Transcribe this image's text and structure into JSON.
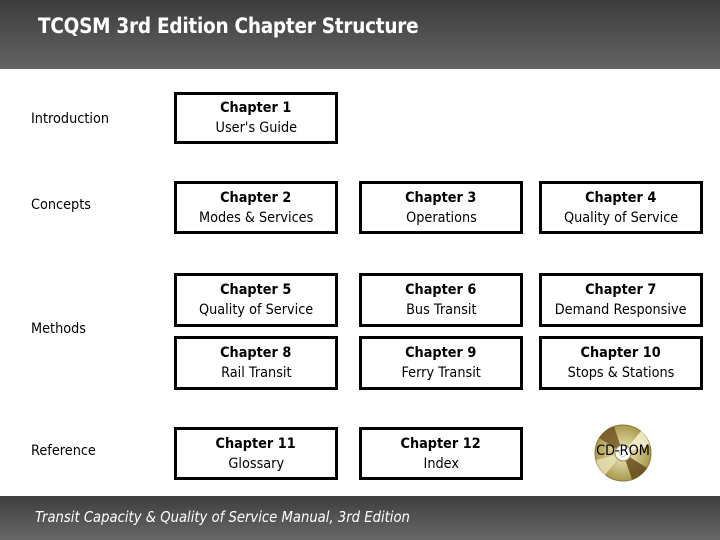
{
  "header": {
    "title": "TCQSM 3rd Edition  Chapter Structure"
  },
  "row_labels": {
    "introduction": "Introduction",
    "concepts": "Concepts",
    "methods": "Methods",
    "reference": "Reference"
  },
  "chapters": [
    {
      "number": "Chapter 1",
      "name": "User's Guide"
    },
    {
      "number": "Chapter 2",
      "name": "Modes & Services"
    },
    {
      "number": "Chapter 3",
      "name": "Operations"
    },
    {
      "number": "Chapter 4",
      "name": "Quality of Service"
    },
    {
      "number": "Chapter 5",
      "name": "Quality of Service"
    },
    {
      "number": "Chapter 6",
      "name": "Bus Transit"
    },
    {
      "number": "Chapter 7",
      "name": "Demand Responsive"
    },
    {
      "number": "Chapter 8",
      "name": "Rail Transit"
    },
    {
      "number": "Chapter 9",
      "name": "Ferry Transit"
    },
    {
      "number": "Chapter 10",
      "name": "Stops & Stations"
    },
    {
      "number": "Chapter 11",
      "name": "Glossary"
    },
    {
      "number": "Chapter 12",
      "name": "Index"
    }
  ],
  "cdrom": {
    "label": "CD-ROM",
    "icon": "cd-disc-icon"
  },
  "footer": {
    "text": "Transit Capacity & Quality of Service Manual, 3rd Edition"
  },
  "colors": {
    "header_bg": "#505050",
    "box_border": "#000000",
    "text_light": "#ffffff"
  }
}
